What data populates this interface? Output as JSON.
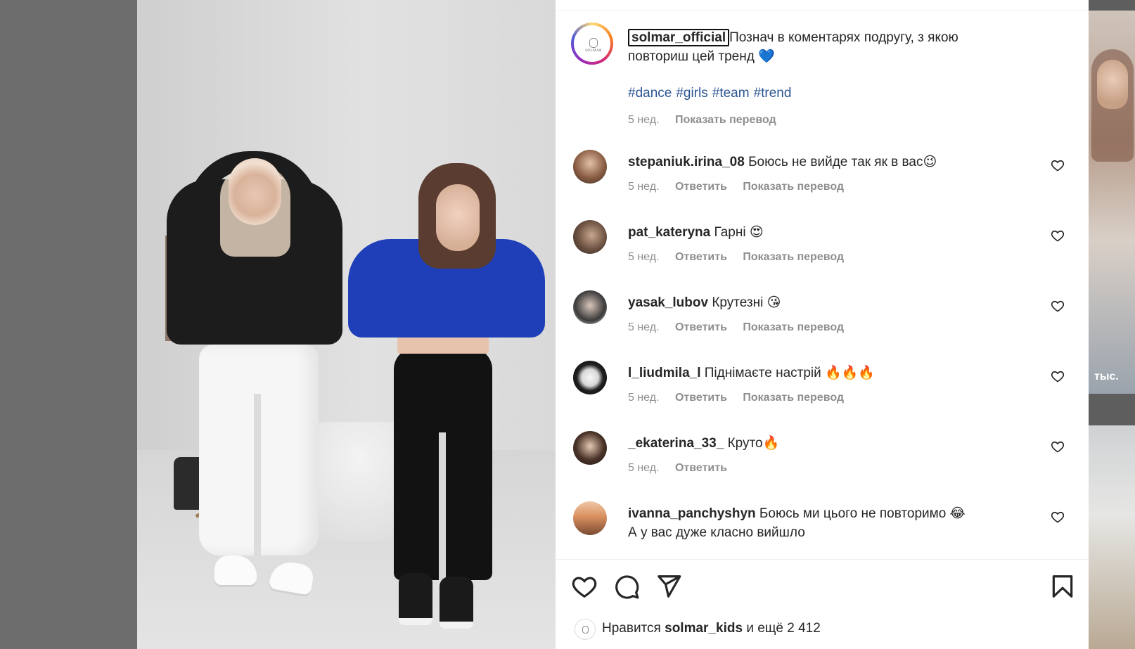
{
  "post": {
    "username": "solmar_official",
    "caption_line1": "Познач в коментарях подругу, з якою",
    "caption_line2": "повториш цей тренд",
    "caption_emoji": "💙",
    "hashtags": [
      "#dance",
      "#girls",
      "#team",
      "#trend"
    ],
    "time": "5 нед.",
    "translate_label": "Показать перевод",
    "brand_logo_text": "SOLMAR"
  },
  "comments": [
    {
      "user": "stepaniuk.irina_08",
      "text": "Боюсь не вийде так як в вас😉",
      "time": "5 нед.",
      "reply": "Ответить",
      "translate": "Показать перевод"
    },
    {
      "user": "pat_kateryna",
      "text": "Гарні 😍",
      "time": "5 нед.",
      "reply": "Ответить",
      "translate": "Показать перевод"
    },
    {
      "user": "yasak_lubov",
      "text": "Крутезні 😘",
      "time": "5 нед.",
      "reply": "Ответить",
      "translate": "Показать перевод"
    },
    {
      "user": "l_liudmila_l",
      "text": "Піднімаєте настрій 🔥🔥🔥",
      "time": "5 нед.",
      "reply": "Ответить",
      "translate": "Показать перевод"
    },
    {
      "user": "_ekaterina_33_",
      "text": "Круто🔥",
      "time": "5 нед.",
      "reply": "Ответить",
      "translate": ""
    },
    {
      "user": "ivanna_panchyshyn",
      "text": "Боюсь ми цього не повторимо 😂",
      "text2": "А у вас дуже класно вийшло"
    }
  ],
  "likes": {
    "prefix": "Нравится",
    "user": "solmar_kids",
    "suffix": "и ещё 2 412"
  },
  "side_thumb": {
    "count_label": "тыс."
  },
  "colors": {
    "hashtag": "#2b5592",
    "meta": "#8e8e8e",
    "text": "#262626"
  },
  "icons": [
    "heart-icon",
    "comment-icon",
    "share-icon",
    "bookmark-icon"
  ]
}
